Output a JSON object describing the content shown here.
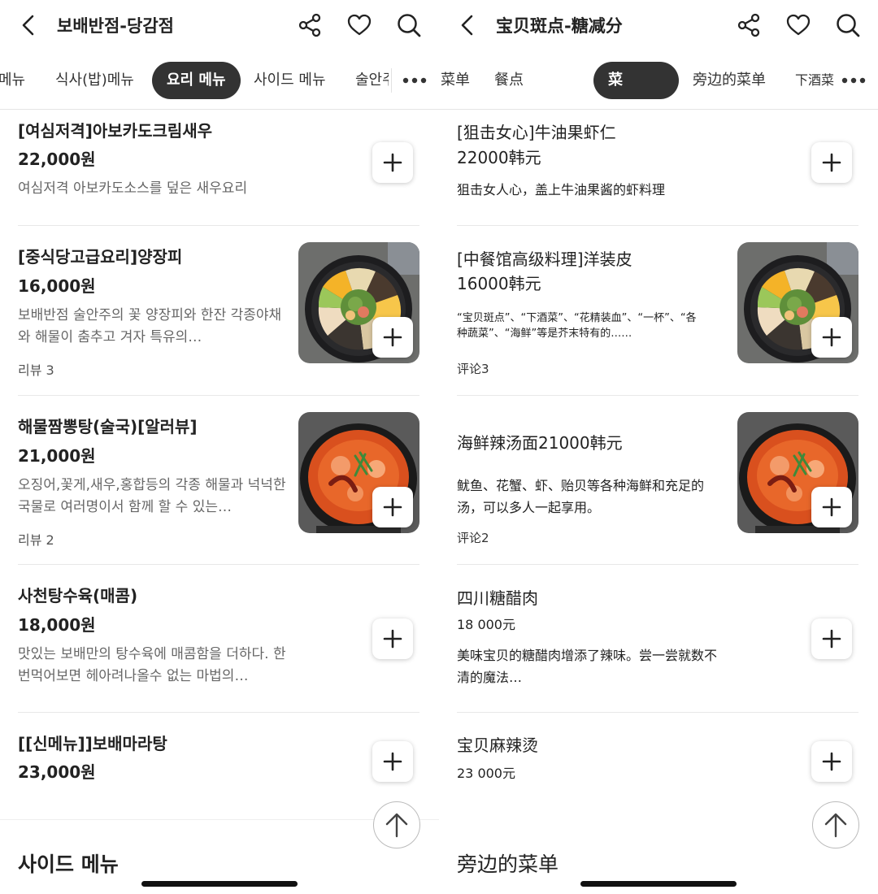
{
  "left": {
    "header": {
      "title": "보배반점-당감점"
    },
    "tabs": [
      {
        "label": "메뉴",
        "active": false
      },
      {
        "label": "식사(밥)메뉴",
        "active": false
      },
      {
        "label": "요리 메뉴",
        "active": true
      },
      {
        "label": "사이드 메뉴",
        "active": false
      },
      {
        "label": "술안주",
        "active": false
      }
    ],
    "items": [
      {
        "name": "[여심저격]아보카도크림새우",
        "price": "22,000원",
        "desc": "여심저격 아보카도소스를 덮은 새우요리"
      },
      {
        "name": "[중식당고급요리]양장피",
        "price": "16,000원",
        "desc": "보배반점 술안주의 꽃 양장피와 한잔 각종야채와 해물이 춤추고 겨자 특유의…",
        "review": "리뷰 3",
        "image": "salad-platter"
      },
      {
        "name": "해물짬뽕탕(술국)[알러뷰]",
        "price": "21,000원",
        "desc": "오징어,꽃게,새우,홍합등의 각종 해물과 넉넉한 국물로 여러명이서 함께 할 수 있는…",
        "review": "리뷰 2",
        "image": "seafood-soup"
      },
      {
        "name": "사천탕수육(매콤)",
        "price": "18,000원",
        "desc": "맛있는 보배만의 탕수육에 매콤함을 더하다. 한번먹어보면 헤아려나올수 없는 마법의…"
      },
      {
        "name": "[[신메뉴]]보배마라탕",
        "price": "23,000원"
      }
    ],
    "section_title": "사이드 메뉴"
  },
  "right": {
    "header": {
      "title": "宝贝斑点-糖减分"
    },
    "tabs": [
      {
        "label": "菜单",
        "active": false
      },
      {
        "label": "餐点",
        "active": false
      },
      {
        "label": "菜",
        "active": true
      },
      {
        "label": "旁边的菜单",
        "active": false
      },
      {
        "label": "下酒菜",
        "active": false
      }
    ],
    "items": [
      {
        "name": "[狙击女心]牛油果虾仁",
        "price": "22000韩元",
        "desc": "狙击女人心，盖上牛油果酱的虾料理"
      },
      {
        "name": "[中餐馆高级料理]洋装皮",
        "price": "16000韩元",
        "desc": "“宝贝斑点”、“下酒菜”、“花精装血”、“一杯”、“各种蔬菜”、“海鲜”等是芥末特有的……",
        "review": "评论3",
        "image": "salad-platter"
      },
      {
        "name": "海鲜辣汤面21000韩元",
        "price": "",
        "desc": "鱿鱼、花蟹、虾、贻贝等各种海鲜和充足的汤，可以多人一起享用。",
        "review": "评论2",
        "image": "seafood-soup"
      },
      {
        "name": "四川糖醋肉",
        "price": "18 000元",
        "desc": "美味宝贝的糖醋肉增添了辣味。尝一尝就数不清的魔法…"
      },
      {
        "name": "宝贝麻辣烫",
        "price": "23 000元"
      }
    ],
    "section_title": "旁边的菜单"
  },
  "icons": [
    "back-arrow-icon",
    "share-icon",
    "heart-icon",
    "search-icon",
    "more-dots-icon",
    "plus-icon",
    "scroll-up-arrow-icon"
  ],
  "colors": {
    "active_tab_bg": "#333333",
    "active_tab_text": "#ffffff",
    "text": "#222222",
    "muted": "#666666"
  }
}
